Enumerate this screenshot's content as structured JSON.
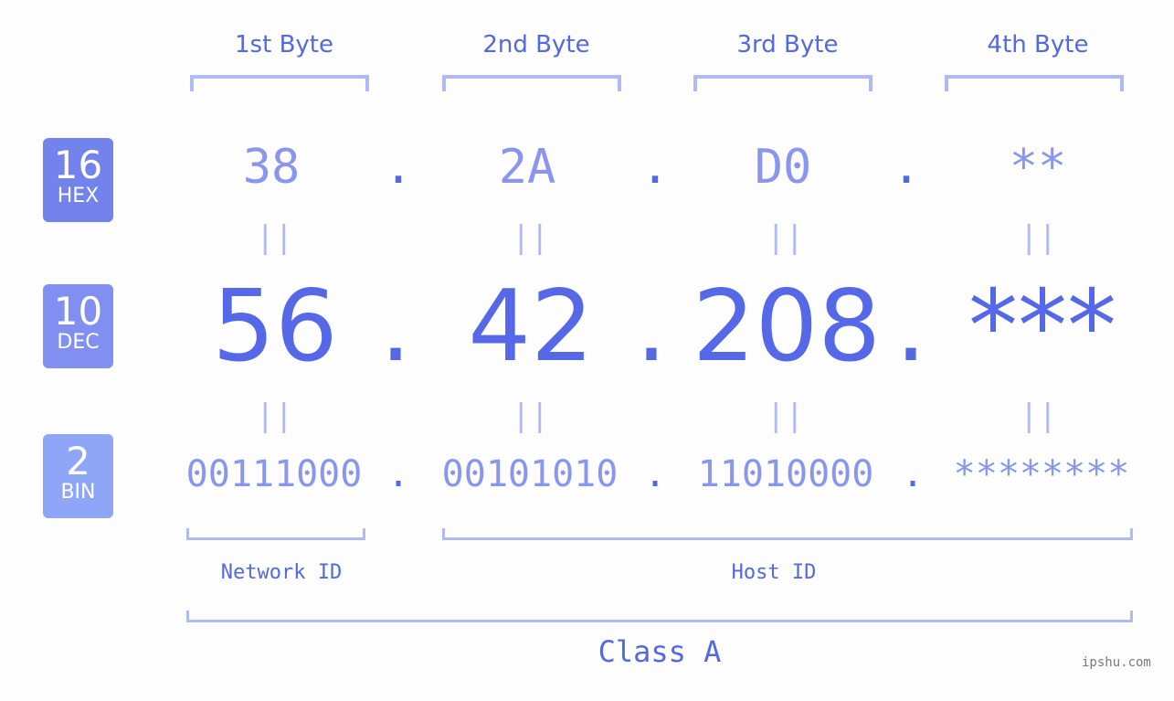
{
  "byte_headers": [
    "1st Byte",
    "2nd Byte",
    "3rd Byte",
    "4th Byte"
  ],
  "badges": [
    {
      "number": "16",
      "label": "HEX",
      "color": "#7383ec"
    },
    {
      "number": "10",
      "label": "DEC",
      "color": "#8190f0"
    },
    {
      "number": "2",
      "label": "BIN",
      "color": "#8fa6f8"
    }
  ],
  "hex": [
    "38",
    "2A",
    "D0",
    "**"
  ],
  "dec": [
    "56",
    "42",
    "208",
    "***"
  ],
  "bin": [
    "00111000",
    "00101010",
    "11010000",
    "********"
  ],
  "separator": ".",
  "equals": "||",
  "network_id_label": "Network ID",
  "host_id_label": "Host ID",
  "class_label": "Class A",
  "watermark": "ipshu.com"
}
